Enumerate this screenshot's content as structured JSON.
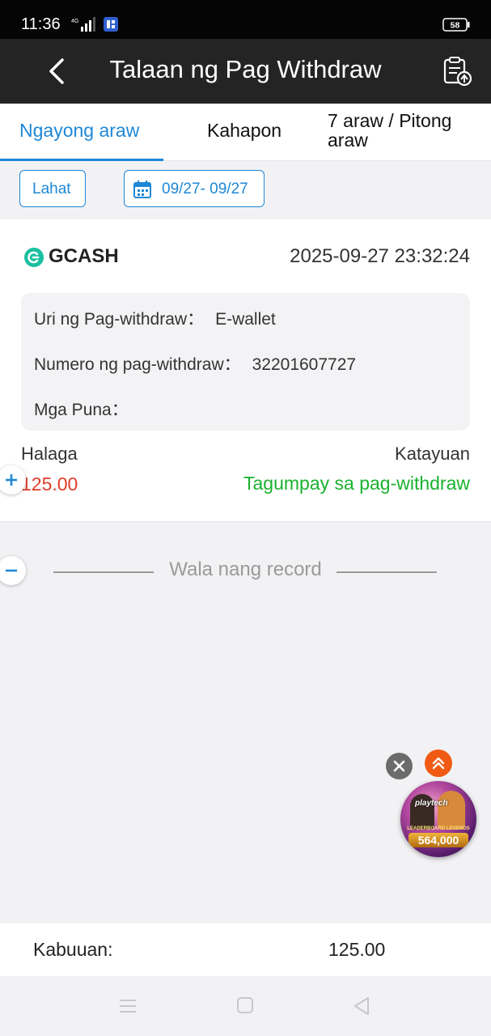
{
  "status_bar": {
    "time": "11:36",
    "network": "4G",
    "battery": "58"
  },
  "header": {
    "title": "Talaan ng Pag Withdraw",
    "back_icon": "chevron-left-icon",
    "action_icon": "clipboard-upload-icon"
  },
  "tabs": [
    {
      "label": "Ngayong araw",
      "active": true
    },
    {
      "label": "Kahapon",
      "active": false
    },
    {
      "label": "7 araw / Pitong araw",
      "active": false
    }
  ],
  "filters": {
    "all_label": "Lahat",
    "date_range": "09/27- 09/27",
    "date_icon": "calendar-icon"
  },
  "record": {
    "provider": "GCASH",
    "datetime": "2025-09-27 23:32:24",
    "type_label": "Uri ng Pag-withdraw：",
    "type_value": "E-wallet",
    "number_label": "Numero ng pag-withdraw：",
    "number_value": "32201607727",
    "remarks_label": "Mga Puna：",
    "remarks_value": "",
    "amount_label": "Halaga",
    "amount_value": "125.00",
    "status_label": "Katayuan",
    "status_value": "Tagumpay sa pag-withdraw"
  },
  "side_buttons": {
    "expand": "+",
    "collapse": "−"
  },
  "no_record_text": "Wala nang record",
  "promo": {
    "brand": "playtech",
    "subtitle": "LEADERBOARD LEGENDS",
    "amount": "564,000"
  },
  "summary": {
    "label": "Kabuuan:",
    "value": "125.00"
  },
  "colors": {
    "accent": "#1e88d6",
    "header_bg": "#242424",
    "amount": "#e03d2a",
    "success": "#19b22f",
    "scroll_top": "#f05a14"
  }
}
